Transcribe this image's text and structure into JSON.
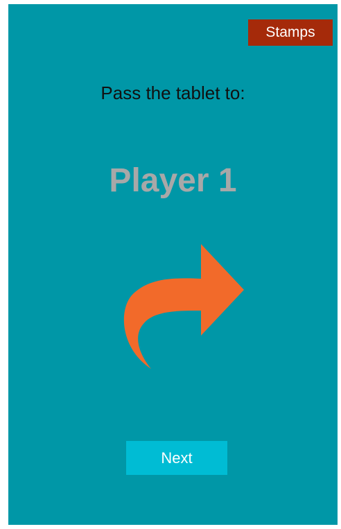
{
  "colors": {
    "background": "#0097A7",
    "stamps_button": "#A52A0A",
    "next_button": "#00BCD4",
    "arrow": "#F26A2A",
    "player_name": "#A8A8A8"
  },
  "header": {
    "stamps_label": "Stamps"
  },
  "main": {
    "prompt": "Pass the tablet to:",
    "player_name": "Player 1",
    "arrow_icon": "curved-forward-arrow-icon",
    "next_label": "Next"
  }
}
